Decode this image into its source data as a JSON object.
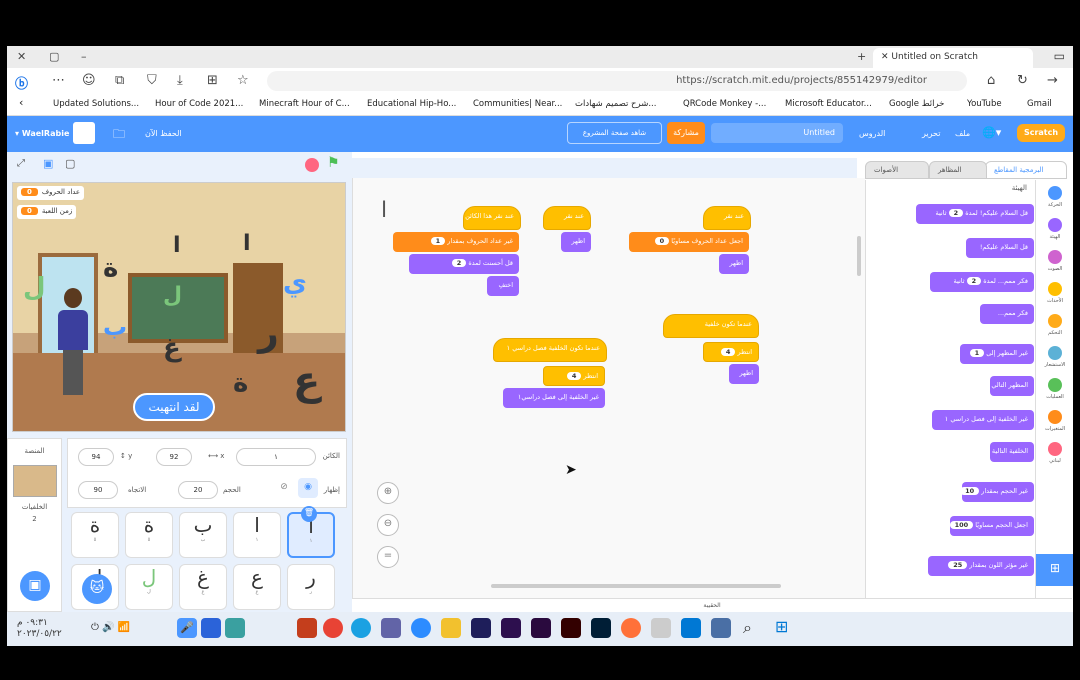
{
  "browser": {
    "tab_title": "Untitled on Scratch",
    "url": "https://scratch.mit.edu/projects/855142979/editor",
    "bookmarks": [
      "Updated Solutions...",
      "Hour of Code 2021...",
      "Minecraft Hour of C...",
      "Educational Hip-Ho...",
      "Communities| Near...",
      "شرح تصميم شهادات...",
      "QRCode Monkey -...",
      "Microsoft Educator...",
      "Google خرائط",
      "YouTube",
      "Gmail"
    ]
  },
  "menu": {
    "user": "WaelRabie",
    "save_now": "الحفظ الآن",
    "see_project": "شاهد صفحة المشروع",
    "share": "مشاركة",
    "title": "Untitled",
    "tutorials": "الدروس",
    "edit": "تحرير",
    "file": "ملف",
    "logo": "Scratch"
  },
  "stage": {
    "monitor1_label": "عداد الحروف",
    "monitor1_value": "0",
    "monitor2_label": "زمن اللعبة",
    "monitor2_value": "0",
    "finished_text": "لقد انتهيت",
    "letters": [
      "ا",
      "ا",
      "ة",
      "ل",
      "ل",
      "ب",
      "غ",
      "ر",
      "ة",
      "ع",
      "ي"
    ]
  },
  "sprite_info": {
    "sprite_label": "الكائن",
    "sprite_name": "١",
    "x_label": "x",
    "x_value": "92",
    "y_label": "y",
    "y_value": "94",
    "show_label": "إظهار",
    "size_label": "الحجم",
    "size_value": "20",
    "direction_label": "الاتجاه",
    "direction_value": "90",
    "stage_label": "المنصة",
    "backdrops_label": "الخلفيات",
    "backdrops_count": "2"
  },
  "sprites": [
    {
      "glyph": "ا",
      "name": "١",
      "selected": true
    },
    {
      "glyph": "ا",
      "name": "١",
      "selected": false
    },
    {
      "glyph": "ب",
      "name": "ب",
      "selected": false
    },
    {
      "glyph": "ة",
      "name": "٥",
      "selected": false
    },
    {
      "glyph": "ة",
      "name": "٥",
      "selected": false
    },
    {
      "glyph": "ر",
      "name": "ر",
      "selected": false
    },
    {
      "glyph": "ع",
      "name": "ع",
      "selected": false
    },
    {
      "glyph": "غ",
      "name": "غ",
      "selected": false
    },
    {
      "glyph": "ل",
      "name": "ل",
      "selected": false
    },
    {
      "glyph": "ل",
      "name": "ل",
      "selected": false
    }
  ],
  "editor_tabs": {
    "code": "البرمجية المقاطع",
    "costumes": "المظاهر",
    "sounds": "الأصوات"
  },
  "palette": {
    "section": "الهيئة",
    "blocks": [
      {
        "text": "قل السلام عليكم! لمدة",
        "value": "2",
        "suffix": "ثانية"
      },
      {
        "text": "قل السلام عليكم!",
        "value": "",
        "suffix": ""
      },
      {
        "text": "فكر ممم... لمدة",
        "value": "2",
        "suffix": "ثانية"
      },
      {
        "text": "فكر ممم...",
        "value": "",
        "suffix": ""
      },
      {
        "text": "غير المظهر إلى",
        "value": "1",
        "suffix": ""
      },
      {
        "text": "المظهر التالي",
        "value": "",
        "suffix": ""
      },
      {
        "text": "غير الخلفية إلى فصل دراسي ١",
        "value": "",
        "suffix": ""
      },
      {
        "text": "الخلفية التالية",
        "value": "",
        "suffix": ""
      },
      {
        "text": "غير الحجم بمقدار",
        "value": "10",
        "suffix": ""
      },
      {
        "text": "اجعل الحجم مساويًا",
        "value": "100",
        "suffix": "%"
      },
      {
        "text": "غير مؤثر اللون بمقدار",
        "value": "25",
        "suffix": ""
      }
    ]
  },
  "categories": [
    "الحركة",
    "الهيئة",
    "الصوت",
    "الأحداث",
    "التحكم",
    "الاستشعار",
    "العمليات",
    "المتغيرات",
    "لبناتي"
  ],
  "code_blocks": {
    "s1_hat": "عند نقر هذا الكائن",
    "s1_b1": "غير عداد الحروف بمقدار",
    "s1_b1_val": "1",
    "s1_b2": "قل أحسنت لمدة",
    "s1_b2_val": "2",
    "s1_b3": "اختفِ",
    "s2_hat": "عند نقر",
    "s2_b1": "اظهر",
    "s3_hat": "عند نقر",
    "s3_b1": "اجعل عداد الحروف مساويًا",
    "s3_b1_val": "0",
    "s3_b2": "اظهر",
    "s4_hat": "عندما تكون الخلفية فصل دراسي ١",
    "s4_b1": "انتظر",
    "s4_b1_val": "4",
    "s4_b2": "غير الخلفية إلى فصل دراسي١",
    "s5_hat": "عندما تكون خلفية",
    "s5_b1": "انتظر",
    "s5_b1_val": "4",
    "s5_b2": "اظهر"
  },
  "backpack": "الحقيبة",
  "taskbar": {
    "time": "٠٩:٣١ م",
    "date": "٢٠٢٣/٠٥/٢٢"
  },
  "colors": {
    "scratch_blue": "#4c97ff",
    "events_yellow": "#ffbf00",
    "variables_orange": "#ff8c1a",
    "looks_purple": "#9966ff"
  }
}
